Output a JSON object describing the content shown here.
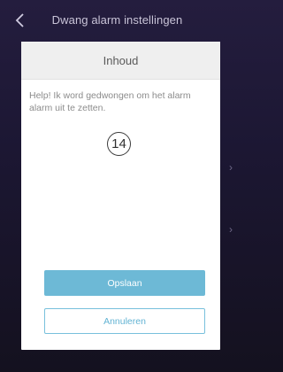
{
  "topbar": {
    "title": "Dwang alarm instellingen",
    "back_icon": "chevron-left-icon"
  },
  "side_icons": [
    "chevron-right-icon",
    "chevron-right-icon"
  ],
  "dialog": {
    "title": "Inhoud",
    "message": "Help! Ik word gedwongen om het alarm alarm uit te zetten.",
    "badge_number": "14",
    "save_label": "Opslaan",
    "cancel_label": "Annuleren"
  },
  "colors": {
    "background": "#1c1733",
    "primary_button": "#6db9d6",
    "outline_button": "#62b3d3",
    "dialog_header": "#efefef"
  }
}
